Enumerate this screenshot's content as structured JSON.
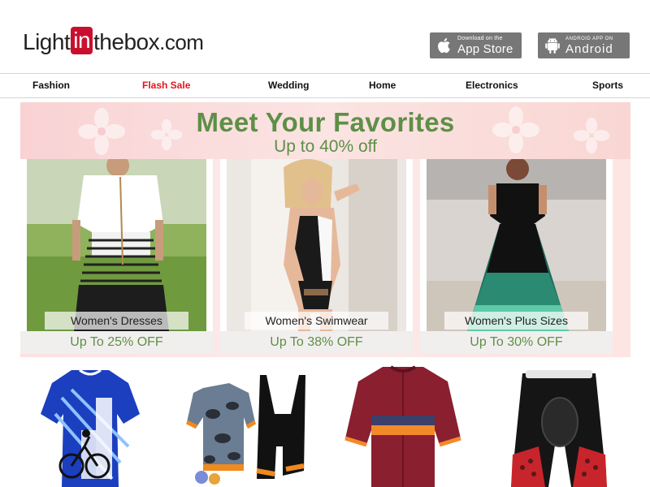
{
  "logo": {
    "part1": "Light",
    "part2": "in",
    "part3": "thebox",
    "part4": ".com"
  },
  "app_store": {
    "small": "Download on the",
    "big": "App Store",
    "icon": "apple-icon"
  },
  "android_app": {
    "small": "ANDROID APP ON",
    "big": "Android",
    "icon": "android-icon"
  },
  "nav": {
    "items": [
      {
        "label": "Fashion"
      },
      {
        "label": "Flash Sale"
      },
      {
        "label": "Wedding"
      },
      {
        "label": "Home"
      },
      {
        "label": "Electronics"
      },
      {
        "label": "Sports"
      }
    ]
  },
  "banner": {
    "title": "Meet Your Favorites",
    "subtitle": "Up to 40% off",
    "cards": [
      {
        "label": "Women's Dresses",
        "offer": "Up To 25% OFF"
      },
      {
        "label": "Women's Swimwear",
        "offer": "Up To 38% OFF"
      },
      {
        "label": "Women's Plus Sizes",
        "offer": "Up To 30% OFF"
      }
    ]
  },
  "colors": {
    "accent_red": "#e3161b",
    "banner_green": "#5e8f47",
    "badge_gray": "#777777",
    "logo_red": "#c8102e"
  }
}
